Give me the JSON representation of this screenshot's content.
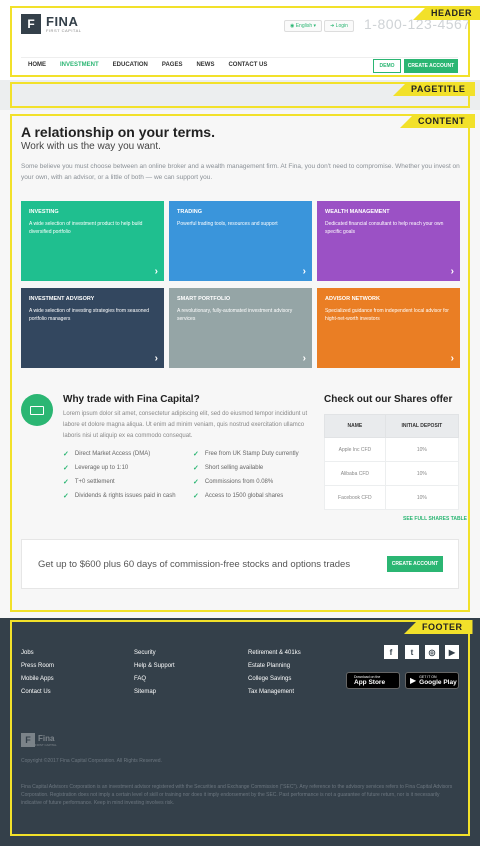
{
  "annotations": {
    "header": "HEADER",
    "pagetitle": "PAGETITLE",
    "content": "CONTENT",
    "footer": "FOOTER"
  },
  "header": {
    "logo_name": "FINA",
    "logo_sub": "FIRST CAPITAL",
    "lang": "English",
    "login": "Login",
    "phone": "1-800-123-4567",
    "nav": [
      "HOME",
      "INVESTMENT",
      "EDUCATION",
      "PAGES",
      "NEWS",
      "CONTACT US"
    ],
    "active_nav": "INVESTMENT",
    "demo": "DEMO",
    "create_account": "CREATE ACCOUNT"
  },
  "content": {
    "title": "A relationship on your terms.",
    "subtitle": "Work with us the way you want.",
    "intro": "Some believe you must choose between an online broker and a wealth management firm. At Fina, you don't need to compromise. Whether you invest on your own, with an advisor, or a little of both — we can support you.",
    "cards": [
      {
        "title": "INVESTING",
        "desc": "A wide selection of investment product to help build diversified portfolio",
        "color": "#1fbf8f"
      },
      {
        "title": "TRADING",
        "desc": "Powerful trading tools, resources and support",
        "color": "#3a95db"
      },
      {
        "title": "WEALTH MANAGEMENT",
        "desc": "Dedicated financial consultant to help reach your own specific goals",
        "color": "#9b51c5"
      },
      {
        "title": "INVESTMENT ADVISORY",
        "desc": "A wide selection of investing strategies from seasoned portfolio managers",
        "color": "#33475f"
      },
      {
        "title": "SMART PORTFOLIO",
        "desc": "A revolutionary, fully-automated investment advisory services",
        "color": "#95a5a6"
      },
      {
        "title": "ADVISOR NETWORK",
        "desc": "Specialized guidance from independent local advisor for hight-net-worth investors",
        "color": "#ea7e24"
      }
    ],
    "why_title": "Why trade with Fina Capital?",
    "why_text": "Lorem ipsum dolor sit amet, consectetur adipiscing elit, sed do eiusmod tempor incididunt ut labore et dolore magna aliqua. Ut enim ad minim veniam, quis nostrud exercitation ullamco laboris nisi ut aliquip ex ea commodo consequat.",
    "features": [
      "Direct Market Access (DMA)",
      "Free from UK Stamp Duty currently",
      "Leverage up to 1:10",
      "Short selling available",
      "T+0 settlement",
      "Commissions from 0.08%",
      "Dividends & rights issues paid in cash",
      "Access to 1500 global shares"
    ],
    "shares_title": "Check out our Shares offer",
    "shares_headers": [
      "NAME",
      "INITIAL DEPOSIT"
    ],
    "shares_rows": [
      [
        "Apple Inc CFD",
        "10%"
      ],
      [
        "Alibaba CFD",
        "10%"
      ],
      [
        "Facebook CFD",
        "10%"
      ]
    ],
    "see_full": "SEE FULL SHARES TABLE",
    "cta_text": "Get up to $600 plus 60 days of commission-free stocks and options trades",
    "cta_button": "CREATE ACCOUNT"
  },
  "footer": {
    "col1": [
      "Jobs",
      "Press Room",
      "Mobile Apps",
      "Contact Us"
    ],
    "col2": [
      "Security",
      "Help & Support",
      "FAQ",
      "Sitemap"
    ],
    "col3": [
      "Retirement & 401ks",
      "Estate Planning",
      "College Savings",
      "Tax Management"
    ],
    "social": [
      "f",
      "t",
      "ig",
      "yt"
    ],
    "appstore_small": "Download on the",
    "appstore_big": "App Store",
    "googleplay_small": "GET IT ON",
    "googleplay_big": "Google Play",
    "logo_name": "Fina",
    "logo_sub": "FIRST CAPITAL",
    "copyright": "Copyright ©2017 Fina Capital Corporation. All Rights Reserved.",
    "disclaimer": "Fina Capital Advisors Corporation is an investment advisor registered with the Securities and Exchange Commission (\"SEC\"). Any reference to the advisory services refers to Fina Capital Advisors Corporation. Registration does not imply a certain level of skill or training nor does it imply endorsement by the SEC. Past performance is not a guarantee of future return, nor is it necessarily indicative of future performance. Keep in mind investing involves risk."
  }
}
